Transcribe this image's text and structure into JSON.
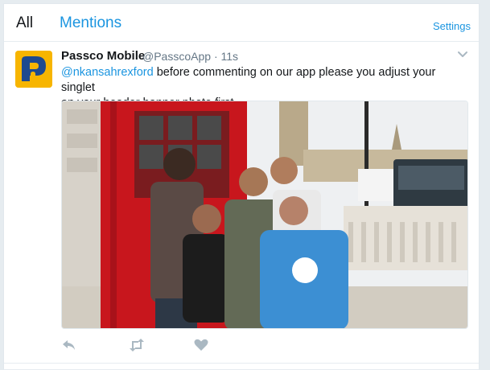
{
  "tabs": {
    "all_label": "All",
    "mentions_label": "Mentions",
    "settings_label": "Settings"
  },
  "tweet": {
    "author_name": "Passco Mobile",
    "author_handle": "@PasscoApp",
    "separator": "·",
    "time": "11s",
    "mention": "@nkansahrexford",
    "text_line1_rest": " before commenting on our app please you adjust your singlet",
    "text_line2": "on your header banner photo first...",
    "avatar_icon": "passco-logo-icon",
    "media_icon": "group-photo-london-phone-booth",
    "actions": [
      "reply-icon",
      "retweet-icon",
      "like-icon"
    ]
  },
  "colors": {
    "accent": "#1b95e0",
    "text": "#14171a",
    "muted": "#657786",
    "icon": "#aab8c2",
    "avatar_bg": "#f7b500",
    "avatar_dark": "#1e4a8f"
  }
}
